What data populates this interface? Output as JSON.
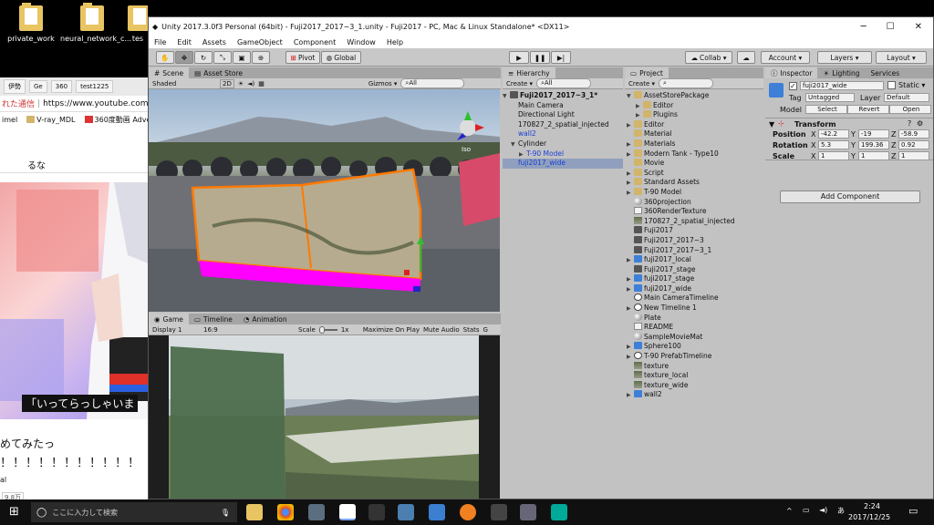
{
  "desktop": {
    "icons": [
      {
        "label": "private_work"
      },
      {
        "label": "neural_network_c..."
      },
      {
        "label": "tes"
      }
    ]
  },
  "browser": {
    "tabs": [
      "伊勢",
      "Ge",
      "360",
      "test1225"
    ],
    "address_prefix": "れた通信",
    "address_url": "https://www.youtube.com/w",
    "bookmarks": [
      "imel",
      "V-ray_MDL",
      "360度動画 Adve"
    ],
    "search_text": "るな",
    "caption": "「いってらっしゃいま",
    "line1": "めてみたっ",
    "line2": "！！！！！！！！！！！",
    "line3": "al",
    "badge": "9.8万"
  },
  "unity": {
    "title": "Unity 2017.3.0f3 Personal (64bit) - Fuji2017_2017~3_1.unity - Fuji2017 - PC, Mac & Linux Standalone* <DX11>",
    "menu": [
      "File",
      "Edit",
      "Assets",
      "GameObject",
      "Component",
      "Window",
      "Help"
    ],
    "toolbar": {
      "pivot": "Pivot",
      "global": "Global",
      "collab": "Collab ▾",
      "account": "Account ▾",
      "layers": "Layers ▾",
      "layout": "Layout ▾"
    },
    "scene": {
      "tabs": [
        "Scene",
        "Asset Store"
      ],
      "shaded": "Shaded",
      "mode2d": "2D",
      "gizmos": "Gizmos ▾",
      "search": "All",
      "gizmo_label": "Iso"
    },
    "game": {
      "tabs": [
        "Game",
        "Timeline",
        "Animation"
      ],
      "display": "Display 1",
      "aspect": "16:9",
      "scale_label": "Scale",
      "scale_value": "1x",
      "maximize": "Maximize On Play",
      "mute": "Mute Audio",
      "stats": "Stats",
      "gizmos": "G"
    },
    "hierarchy": {
      "tab": "Hierarchy",
      "create": "Create ▾",
      "search": "All",
      "scene_name": "Fuji2017_2017~3_1*",
      "items": [
        {
          "label": "Main Camera",
          "indent": 1,
          "blue": false,
          "fold": false,
          "selected": false
        },
        {
          "label": "Directional Light",
          "indent": 1,
          "blue": false,
          "fold": false,
          "selected": false
        },
        {
          "label": "170827_2_spatial_injected",
          "indent": 1,
          "blue": false,
          "fold": false,
          "selected": false
        },
        {
          "label": "wall2",
          "indent": 1,
          "blue": true,
          "fold": false,
          "selected": false
        },
        {
          "label": "Cylinder",
          "indent": 1,
          "blue": false,
          "fold": true,
          "selected": false
        },
        {
          "label": "T-90 Model",
          "indent": 2,
          "blue": true,
          "fold": true,
          "selected": false
        },
        {
          "label": "fuji2017_wide",
          "indent": 1,
          "blue": true,
          "fold": false,
          "selected": true
        }
      ]
    },
    "project": {
      "tab": "Project",
      "create": "Create ▾",
      "items": [
        {
          "label": "AssetStorePackage",
          "icon": "folder",
          "fold": "▼",
          "indent": 0
        },
        {
          "label": "Editor",
          "icon": "folder",
          "fold": "▶",
          "indent": 1
        },
        {
          "label": "Plugins",
          "icon": "folder",
          "fold": "▶",
          "indent": 1
        },
        {
          "label": "Editor",
          "icon": "folder",
          "fold": "▶",
          "indent": 0
        },
        {
          "label": "Material",
          "icon": "folder",
          "fold": "",
          "indent": 0
        },
        {
          "label": "Materials",
          "icon": "folder",
          "fold": "▶",
          "indent": 0
        },
        {
          "label": "Modern Tank - Type10",
          "icon": "folder",
          "fold": "▶",
          "indent": 0
        },
        {
          "label": "Movie",
          "icon": "folder",
          "fold": "",
          "indent": 0
        },
        {
          "label": "Script",
          "icon": "folder",
          "fold": "▶",
          "indent": 0
        },
        {
          "label": "Standard Assets",
          "icon": "folder",
          "fold": "▶",
          "indent": 0
        },
        {
          "label": "T-90 Model",
          "icon": "folder",
          "fold": "▶",
          "indent": 0
        },
        {
          "label": "360projection",
          "icon": "mat",
          "fold": "",
          "indent": 0
        },
        {
          "label": "360RenderTexture",
          "icon": "doc",
          "fold": "",
          "indent": 0
        },
        {
          "label": "170827_2_spatial_injected",
          "icon": "tex",
          "fold": "",
          "indent": 0
        },
        {
          "label": "Fuji2017",
          "icon": "scene",
          "fold": "",
          "indent": 0
        },
        {
          "label": "Fuji2017_2017~3",
          "icon": "scene",
          "fold": "",
          "indent": 0
        },
        {
          "label": "Fuji2017_2017~3_1",
          "icon": "scene",
          "fold": "",
          "indent": 0
        },
        {
          "label": "fuji2017_local",
          "icon": "prefab",
          "fold": "▶",
          "indent": 0
        },
        {
          "label": "Fuji2017_stage",
          "icon": "scene",
          "fold": "",
          "indent": 0
        },
        {
          "label": "fuji2017_stage",
          "icon": "prefab",
          "fold": "▶",
          "indent": 0
        },
        {
          "label": "fuji2017_wide",
          "icon": "prefab",
          "fold": "▶",
          "indent": 0
        },
        {
          "label": "Main CameraTimeline",
          "icon": "time",
          "fold": "",
          "indent": 0
        },
        {
          "label": "New Timeline 1",
          "icon": "time",
          "fold": "▶",
          "indent": 0
        },
        {
          "label": "Plate",
          "icon": "mat",
          "fold": "",
          "indent": 0
        },
        {
          "label": "README",
          "icon": "doc",
          "fold": "",
          "indent": 0
        },
        {
          "label": "SampleMovieMat",
          "icon": "mat",
          "fold": "",
          "indent": 0
        },
        {
          "label": "Sphere100",
          "icon": "prefab",
          "fold": "▶",
          "indent": 0
        },
        {
          "label": "T-90 PrefabTimeline",
          "icon": "time",
          "fold": "▶",
          "indent": 0
        },
        {
          "label": "texture",
          "icon": "tex",
          "fold": "",
          "indent": 0
        },
        {
          "label": "texture_local",
          "icon": "tex",
          "fold": "",
          "indent": 0
        },
        {
          "label": "texture_wide",
          "icon": "tex",
          "fold": "",
          "indent": 0
        },
        {
          "label": "wall2",
          "icon": "prefab",
          "fold": "▶",
          "indent": 0
        }
      ]
    },
    "inspector": {
      "tabs": [
        "Inspector",
        "Lighting",
        "Services"
      ],
      "object_name": "fuji2017_wide",
      "static_label": "Static ▾",
      "tag_label": "Tag",
      "tag_value": "Untagged",
      "layer_label": "Layer",
      "layer_value": "Default",
      "model_label": "Model",
      "select": "Select",
      "revert": "Revert",
      "open": "Open",
      "transform_title": "Transform",
      "position_label": "Position",
      "rotation_label": "Rotation",
      "scale_label": "Scale",
      "axis_x": "X",
      "axis_y": "Y",
      "axis_z": "Z",
      "position": {
        "x": "-42.2",
        "y": "-19",
        "z": "-58.9"
      },
      "rotation": {
        "x": "5.3",
        "y": "199.36",
        "z": "0.92"
      },
      "scale": {
        "x": "1",
        "y": "1",
        "z": "1"
      },
      "add_component": "Add Component"
    }
  },
  "taskbar": {
    "search_placeholder": "ここに入力して検索",
    "time": "2:24",
    "date": "2017/12/25"
  },
  "colors": {
    "selection": "#8f9fbd",
    "prefab_blue": "#1b3fd6",
    "magenta": "#ff00ff",
    "orange_outline": "#ff7a00"
  }
}
